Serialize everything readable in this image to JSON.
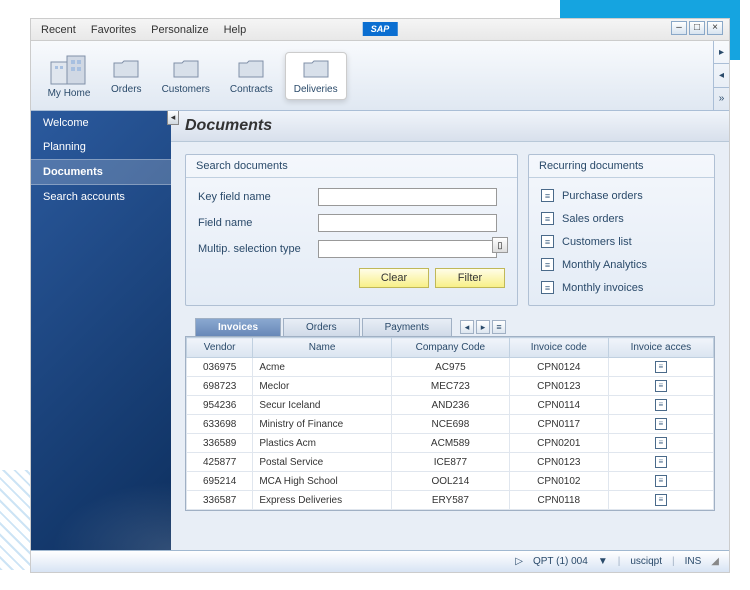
{
  "menu": {
    "recent": "Recent",
    "favorites": "Favorites",
    "personalize": "Personalize",
    "help": "Help"
  },
  "tabs": {
    "home": "My Home",
    "orders": "Orders",
    "customers": "Customers",
    "contracts": "Contracts",
    "deliveries": "Deliveries"
  },
  "sidebar": {
    "welcome": "Welcome",
    "planning": "Planning",
    "documents": "Documents",
    "search_accounts": "Search accounts"
  },
  "page_title": "Documents",
  "search": {
    "panel_title": "Search documents",
    "key_field": "Key field name",
    "field_name": "Field name",
    "multi_sel": "Multip. selection type",
    "clear": "Clear",
    "filter": "Filter"
  },
  "recurring": {
    "title": "Recurring documents",
    "items": {
      "0": "Purchase orders",
      "1": "Sales orders",
      "2": "Customers list",
      "3": "Monthly Analytics",
      "4": "Monthly invoices"
    }
  },
  "data_tabs": {
    "invoices": "Invoices",
    "orders": "Orders",
    "payments": "Payments"
  },
  "table": {
    "headers": {
      "vendor": "Vendor",
      "name": "Name",
      "company": "Company Code",
      "invoice": "Invoice code",
      "access": "Invoice acces"
    },
    "rows": {
      "0": {
        "vendor": "036975",
        "name": "Acme",
        "company": "AC975",
        "invoice": "CPN0124"
      },
      "1": {
        "vendor": "698723",
        "name": "Meclor",
        "company": "MEC723",
        "invoice": "CPN0123"
      },
      "2": {
        "vendor": "954236",
        "name": "Secur Iceland",
        "company": "AND236",
        "invoice": "CPN0114"
      },
      "3": {
        "vendor": "633698",
        "name": "Ministry of Finance",
        "company": "NCE698",
        "invoice": "CPN0117"
      },
      "4": {
        "vendor": "336589",
        "name": "Plastics Acm",
        "company": "ACM589",
        "invoice": "CPN0201"
      },
      "5": {
        "vendor": "425877",
        "name": "Postal Service",
        "company": "ICE877",
        "invoice": "CPN0123"
      },
      "6": {
        "vendor": "695214",
        "name": "MCA High School",
        "company": "OOL214",
        "invoice": "CPN0102"
      },
      "7": {
        "vendor": "336587",
        "name": "Express Deliveries",
        "company": "ERY587",
        "invoice": "CPN0118"
      }
    }
  },
  "status": {
    "system": "QPT (1) 004",
    "user": "usciqpt",
    "mode": "INS",
    "logo": "SAP"
  }
}
